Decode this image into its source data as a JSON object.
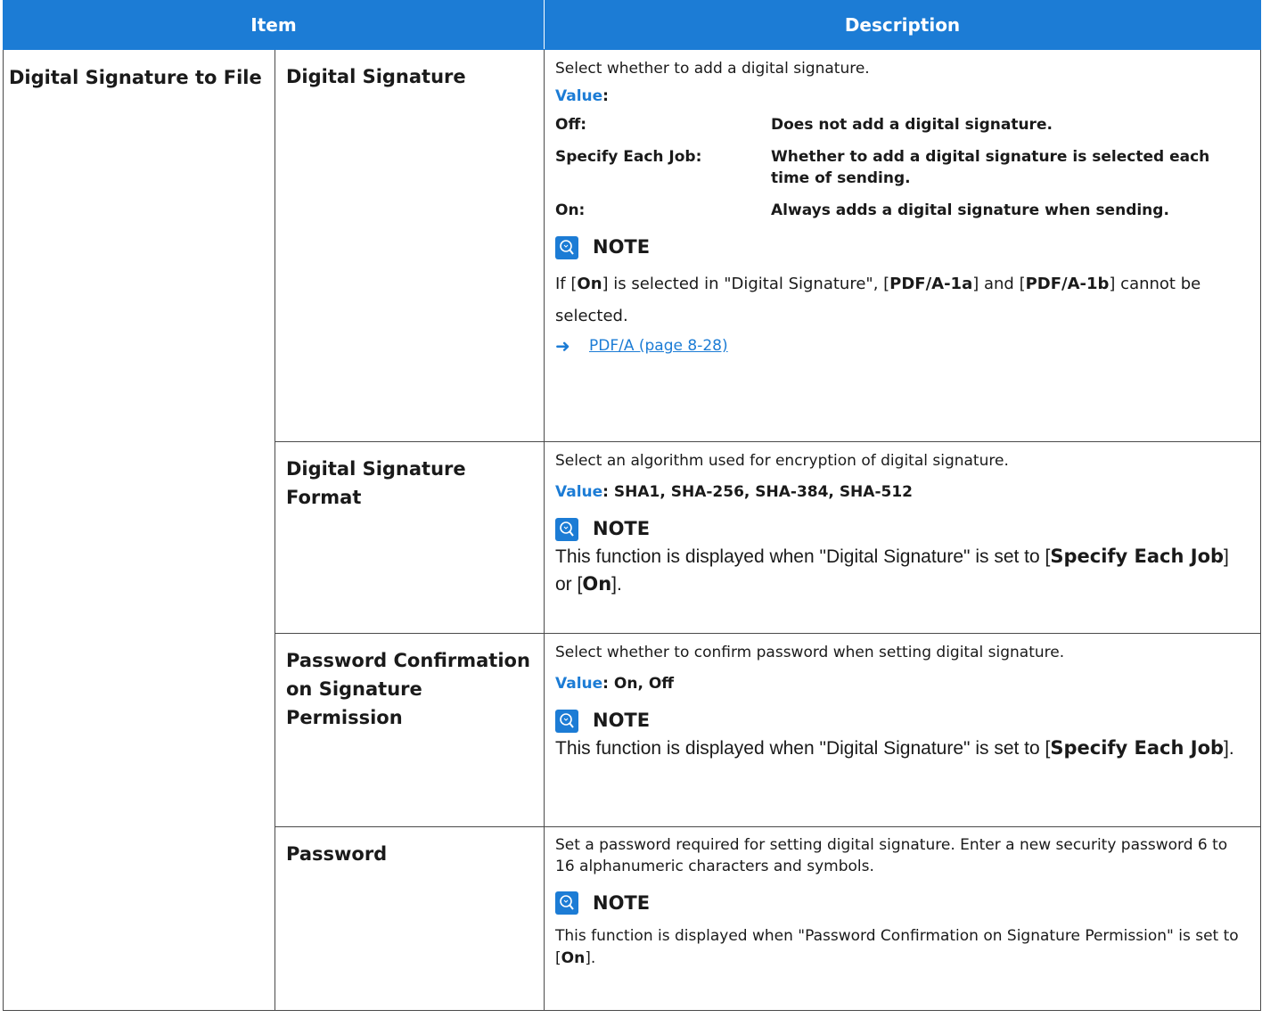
{
  "header": {
    "item": "Item",
    "description": "Description"
  },
  "group_label": "Digital Signature to File",
  "rows": [
    {
      "label": "Digital Signature",
      "intro": "Select whether to add a digital signature.",
      "value_label": "Value",
      "value_text": "",
      "options": [
        {
          "key": "Off:",
          "value": "Does not add a digital signature."
        },
        {
          "key": "Specify Each Job:",
          "value": "Whether to add a digital signature is selected each time of sending."
        },
        {
          "key": "On:",
          "value": "Always adds a digital signature when sending."
        }
      ],
      "note_title": "NOTE",
      "note": {
        "t1": "If [",
        "b1": "On",
        "t2": "] is selected in \"Digital Signature\", [",
        "b2": "PDF/A-1a",
        "t3": "] and [",
        "b3": "PDF/A-1b",
        "t4": "] cannot be selected."
      },
      "link_text": "PDF/A (page 8-28)"
    },
    {
      "label": "Digital Signature Format",
      "intro": "Select an algorithm used for encryption of digital signature.",
      "value_label": "Value",
      "value_text": ": SHA1, SHA-256, SHA-384, SHA-512",
      "note_title": "NOTE",
      "note": {
        "t1": "This function is displayed when \"Digital Signature\" is set to [",
        "b1": "Specify Each Job",
        "t2": "] or [",
        "b2": "On",
        "t3": "]."
      }
    },
    {
      "label": "Password Confirmation on Signature Permission",
      "intro": "Select whether to confirm password when setting digital signature.",
      "value_label": "Value",
      "value_text": ": On, Off",
      "note_title": "NOTE",
      "note": {
        "t1": "This function is displayed when \"Digital Signature\" is set to [",
        "b1": "Specify Each Job",
        "t2": "]."
      }
    },
    {
      "label": "Password",
      "intro": "Set a password required for setting digital signature. Enter a new security password 6 to 16 alphanumeric characters and symbols.",
      "note_title": "NOTE",
      "note": {
        "t1": "This function is displayed when \"Password Confirmation on Signature Permission\" is set to [",
        "b1": "On",
        "t2": "]."
      }
    }
  ],
  "colors": {
    "header_bg": "#1c7cd5",
    "accent": "#1c7cd5",
    "border": "#4a4a4a"
  },
  "icons": {
    "note": "note-lightbulb-icon",
    "link": "arrow-right-icon"
  }
}
